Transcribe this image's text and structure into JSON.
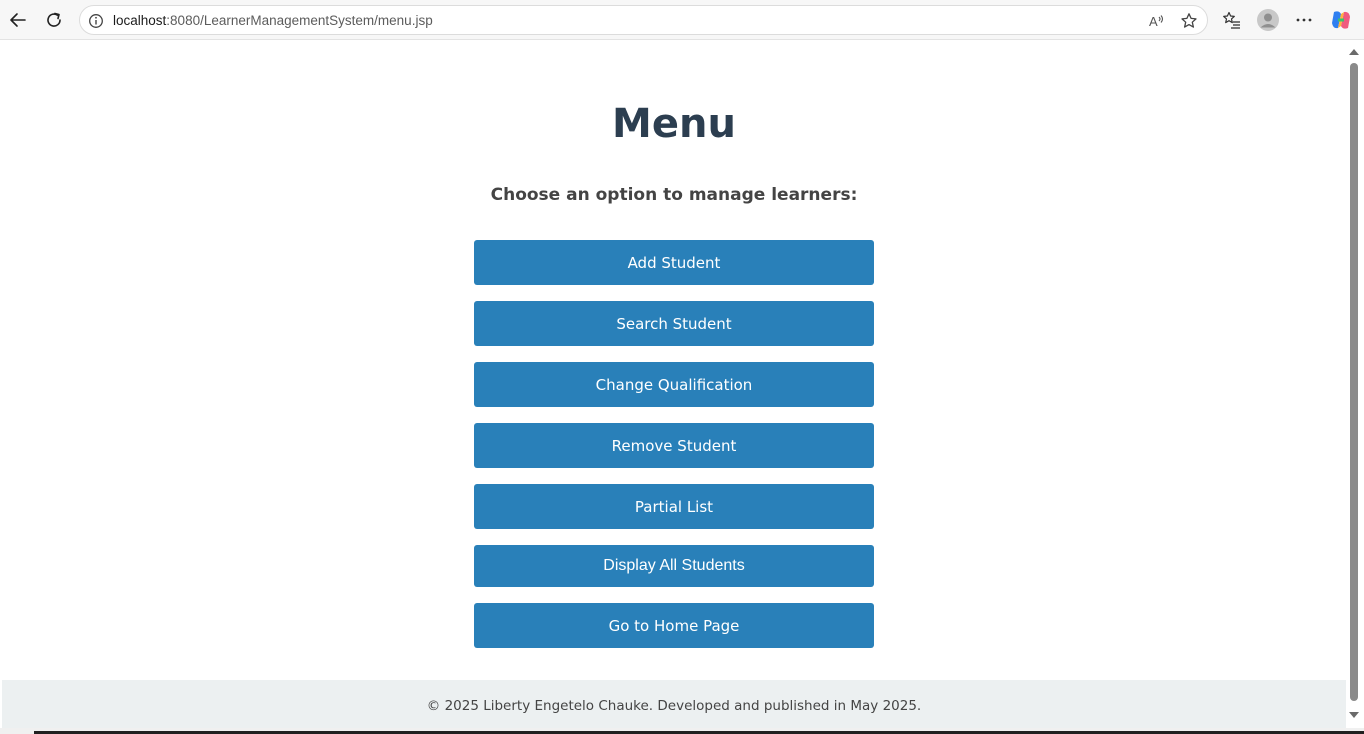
{
  "browser": {
    "url_host": "localhost",
    "url_rest": ":8080/LearnerManagementSystem/menu.jsp",
    "icons": {
      "back": "arrow-left-icon",
      "reload": "refresh-icon",
      "site_info": "info-icon",
      "read_aloud": "read-aloud-icon",
      "favorite": "star-icon",
      "favorites": "favorites-list-icon",
      "profile": "profile-avatar-icon",
      "more": "ellipsis-icon",
      "copilot": "copilot-icon"
    }
  },
  "page": {
    "title": "Menu",
    "subtitle": "Choose an option to manage learners:",
    "buttons": [
      {
        "label": "Add Student"
      },
      {
        "label": "Search Student"
      },
      {
        "label": "Change Qualification"
      },
      {
        "label": "Remove Student"
      },
      {
        "label": "Partial List"
      },
      {
        "label": "Display All Students"
      },
      {
        "label": "Go to Home Page"
      }
    ],
    "footer": "© 2025 Liberty Engetelo Chauke. Developed and published in May 2025."
  },
  "colors": {
    "button_bg": "#2980b9",
    "title": "#2c3e50",
    "footer_bg": "#ecf0f1"
  }
}
